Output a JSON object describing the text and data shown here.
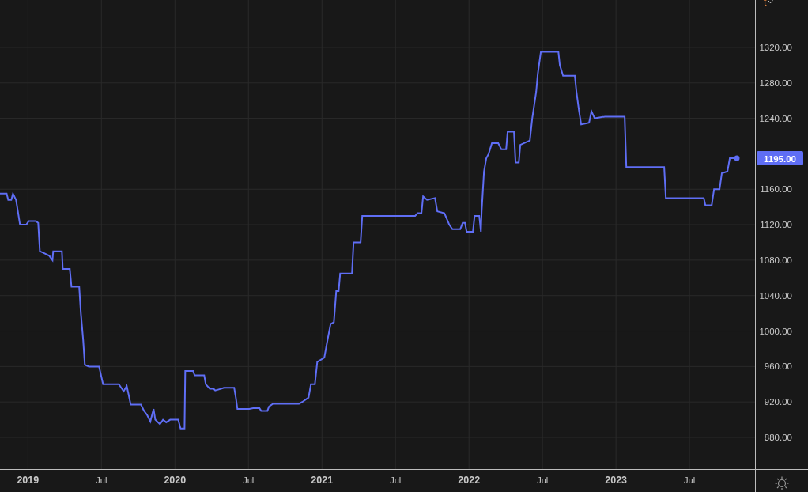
{
  "unit_menu": {
    "label": "t"
  },
  "price_label": "1195.00",
  "chart": {
    "chart_data": {
      "type": "line",
      "xlim": [
        2018.81,
        2024.306
      ],
      "ylim": [
        844.3,
        1373.5
      ],
      "grid": true,
      "x": [
        2018.81,
        2018.855,
        2018.866,
        2018.887,
        2018.898,
        2018.919,
        2018.946,
        2018.989,
        2019.005,
        2019.054,
        2019.07,
        2019.081,
        2019.108,
        2019.145,
        2019.167,
        2019.172,
        2019.231,
        2019.237,
        2019.285,
        2019.296,
        2019.349,
        2019.36,
        2019.376,
        2019.387,
        2019.414,
        2019.484,
        2019.511,
        2019.618,
        2019.651,
        2019.672,
        2019.683,
        2019.699,
        2019.769,
        2019.79,
        2019.812,
        2019.833,
        2019.855,
        2019.866,
        2019.898,
        2019.919,
        2019.941,
        2019.968,
        2020.022,
        2020.038,
        2020.065,
        2020.07,
        2020.124,
        2020.134,
        2020.199,
        2020.21,
        2020.237,
        2020.263,
        2020.274,
        2020.317,
        2020.333,
        2020.403,
        2020.414,
        2020.425,
        2020.505,
        2020.532,
        2020.575,
        2020.586,
        2020.629,
        2020.64,
        2020.667,
        2020.844,
        2020.866,
        2020.909,
        2020.925,
        2020.952,
        2020.968,
        2021.016,
        2021.038,
        2021.059,
        2021.081,
        2021.097,
        2021.113,
        2021.124,
        2021.204,
        2021.215,
        2021.263,
        2021.274,
        2021.634,
        2021.651,
        2021.677,
        2021.688,
        2021.715,
        2021.769,
        2021.785,
        2021.833,
        2021.866,
        2021.887,
        2021.941,
        2021.957,
        2021.973,
        2021.984,
        2022.027,
        2022.038,
        2022.07,
        2022.081,
        2022.086,
        2022.102,
        2022.118,
        2022.134,
        2022.156,
        2022.199,
        2022.22,
        2022.253,
        2022.263,
        2022.306,
        2022.317,
        2022.339,
        2022.349,
        2022.414,
        2022.43,
        2022.457,
        2022.468,
        2022.489,
        2022.608,
        2022.618,
        2022.64,
        2022.72,
        2022.731,
        2022.747,
        2022.763,
        2022.817,
        2022.833,
        2022.855,
        2022.925,
        2023.059,
        2023.07,
        2023.328,
        2023.339,
        2023.597,
        2023.608,
        2023.651,
        2023.667,
        2023.704,
        2023.72,
        2023.758,
        2023.774,
        2023.806
      ],
      "series": [
        {
          "color": "#5f6ef5",
          "values": [
            1155,
            1155,
            1148,
            1148,
            1155,
            1148,
            1120,
            1120,
            1124,
            1124,
            1122,
            1090,
            1088,
            1085,
            1080,
            1090,
            1090,
            1070,
            1070,
            1050,
            1050,
            1020,
            990,
            962,
            960,
            960,
            940,
            940,
            932,
            938,
            930,
            917,
            917,
            910,
            905,
            898,
            912,
            900,
            895,
            900,
            897,
            900,
            900,
            890,
            890,
            955,
            955,
            950,
            950,
            940,
            935,
            935,
            933,
            935,
            936,
            936,
            925,
            912,
            912,
            913,
            913,
            910,
            910,
            915,
            918,
            918,
            920,
            925,
            940,
            940,
            965,
            970,
            990,
            1008,
            1010,
            1045,
            1045,
            1065,
            1065,
            1100,
            1100,
            1130,
            1130,
            1133,
            1133,
            1152,
            1148,
            1150,
            1135,
            1133,
            1120,
            1115,
            1115,
            1122,
            1122,
            1112,
            1112,
            1130,
            1130,
            1112,
            1135,
            1180,
            1195,
            1200,
            1212,
            1212,
            1205,
            1205,
            1225,
            1225,
            1190,
            1190,
            1210,
            1215,
            1240,
            1270,
            1290,
            1315,
            1315,
            1300,
            1288,
            1288,
            1270,
            1250,
            1233,
            1235,
            1248,
            1240,
            1242,
            1242,
            1185,
            1185,
            1150,
            1150,
            1142,
            1142,
            1160,
            1160,
            1178,
            1180,
            1195,
            1195
          ]
        }
      ],
      "xticks": [
        {
          "value": 2019,
          "label": "2019"
        },
        {
          "value": 2019.5,
          "label": "Jul"
        },
        {
          "value": 2020,
          "label": "2020"
        },
        {
          "value": 2020.5,
          "label": "Jul"
        },
        {
          "value": 2021,
          "label": "2021"
        },
        {
          "value": 2021.5,
          "label": "Jul"
        },
        {
          "value": 2022,
          "label": "2022"
        },
        {
          "value": 2022.5,
          "label": "Jul"
        },
        {
          "value": 2023,
          "label": "2023"
        },
        {
          "value": 2023.5,
          "label": "Jul"
        }
      ],
      "yticks": [
        {
          "value": 880,
          "label": "880.00"
        },
        {
          "value": 920,
          "label": "920.00"
        },
        {
          "value": 960,
          "label": "960.00"
        },
        {
          "value": 1000,
          "label": "1000.00"
        },
        {
          "value": 1040,
          "label": "1040.00"
        },
        {
          "value": 1080,
          "label": "1080.00"
        },
        {
          "value": 1120,
          "label": "1120.00"
        },
        {
          "value": 1160,
          "label": "1160.00"
        },
        {
          "value": 1240,
          "label": "1240.00"
        },
        {
          "value": 1280,
          "label": "1280.00"
        },
        {
          "value": 1320,
          "label": "1320.00"
        }
      ]
    }
  }
}
